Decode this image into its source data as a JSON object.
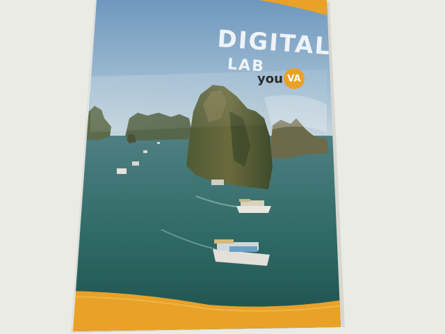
{
  "cover": {
    "title_line1": "DIGITAL",
    "title_line2": "LAB",
    "brand_prefix": "you",
    "brand_badge": "VA"
  },
  "colors": {
    "background": "#ebebe6",
    "accent_orange": "#e9a227",
    "sea": "#2f6b68",
    "sky": "#8eb3cf",
    "title_text": "#eef3f7"
  }
}
